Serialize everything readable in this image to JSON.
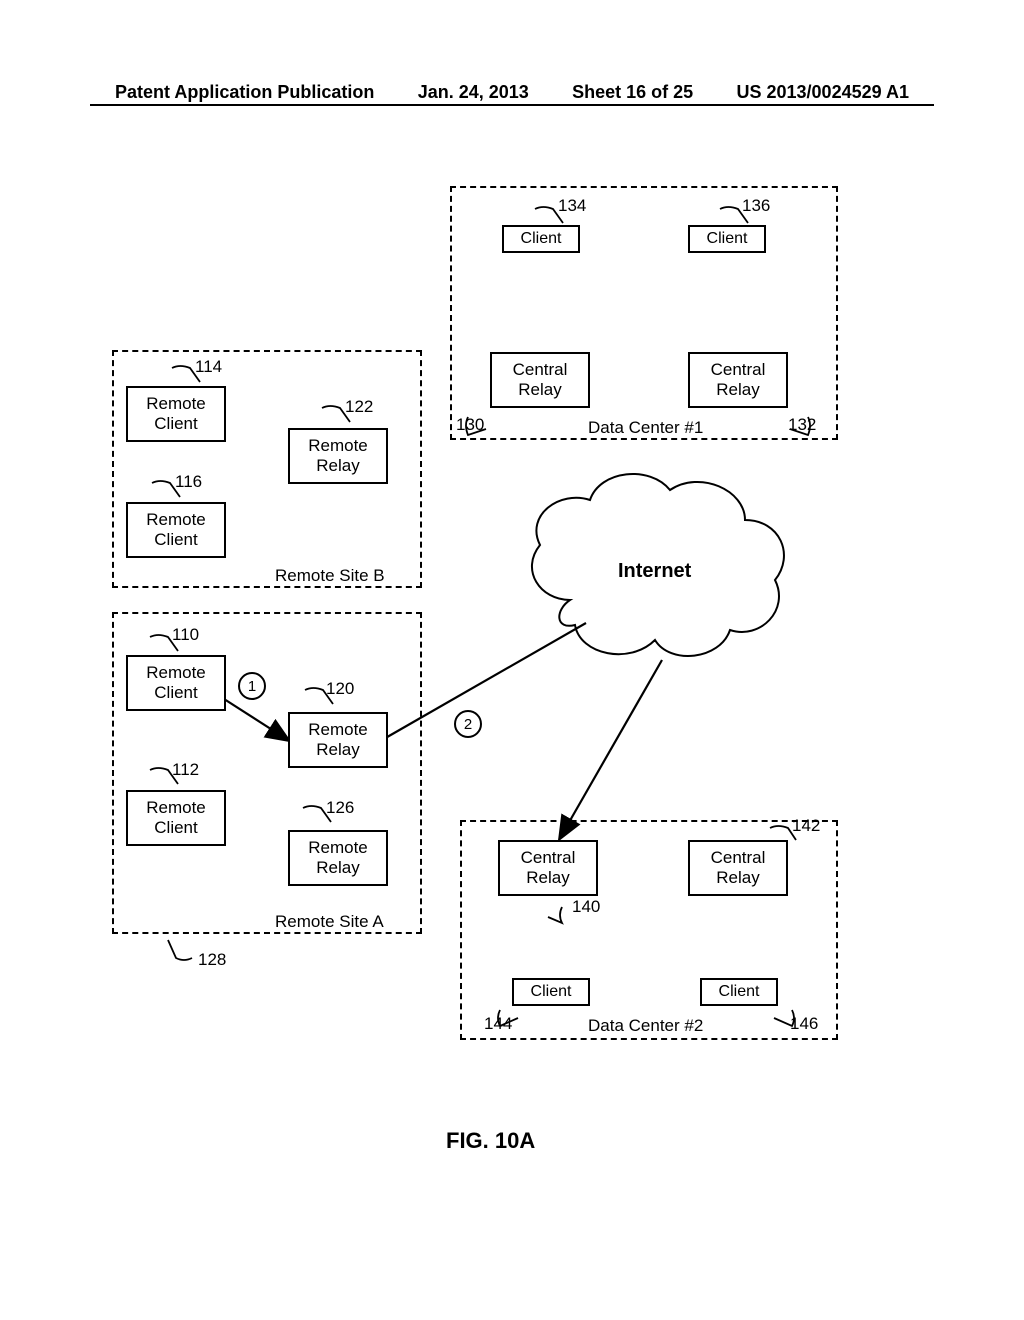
{
  "header": {
    "pub_type": "Patent Application Publication",
    "date": "Jan. 24, 2013",
    "sheet": "Sheet 16 of 25",
    "pub_no": "US 2013/0024529 A1"
  },
  "figure_label": "FIG. 10A",
  "cloud": {
    "label": "Internet"
  },
  "steps": {
    "one": "1",
    "two": "2"
  },
  "sites": {
    "remote_b": {
      "title": "Remote Site B"
    },
    "remote_a": {
      "title": "Remote Site A"
    },
    "dc1": {
      "title": "Data Center #1"
    },
    "dc2": {
      "title": "Data Center #2"
    }
  },
  "nodes": {
    "n110": {
      "label_l1": "Remote",
      "label_l2": "Client",
      "ref": "110"
    },
    "n112": {
      "label_l1": "Remote",
      "label_l2": "Client",
      "ref": "112"
    },
    "n114": {
      "label_l1": "Remote",
      "label_l2": "Client",
      "ref": "114"
    },
    "n116": {
      "label_l1": "Remote",
      "label_l2": "Client",
      "ref": "116"
    },
    "n120": {
      "label_l1": "Remote",
      "label_l2": "Relay",
      "ref": "120"
    },
    "n122": {
      "label_l1": "Remote",
      "label_l2": "Relay",
      "ref": "122"
    },
    "n126": {
      "label_l1": "Remote",
      "label_l2": "Relay",
      "ref": "126"
    },
    "n128": {
      "ref": "128"
    },
    "n130": {
      "label_l1": "Central",
      "label_l2": "Relay",
      "ref": "130"
    },
    "n132": {
      "label_l1": "Central",
      "label_l2": "Relay",
      "ref": "132"
    },
    "n134": {
      "label": "Client",
      "ref": "134"
    },
    "n136": {
      "label": "Client",
      "ref": "136"
    },
    "n140": {
      "label_l1": "Central",
      "label_l2": "Relay",
      "ref": "140"
    },
    "n142": {
      "label_l1": "Central",
      "label_l2": "Relay",
      "ref": "142"
    },
    "n144": {
      "label": "Client",
      "ref": "144"
    },
    "n146": {
      "label": "Client",
      "ref": "146"
    }
  }
}
